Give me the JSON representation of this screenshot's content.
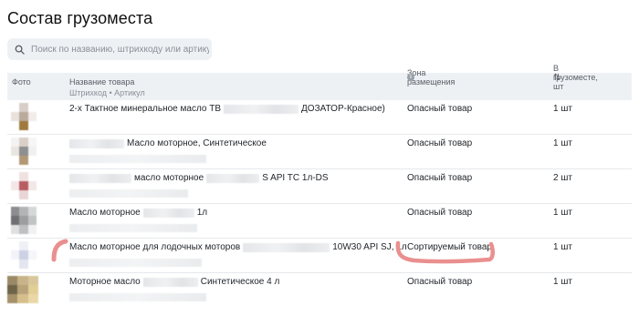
{
  "page": {
    "title": "Состав грузоместа"
  },
  "search": {
    "placeholder": "Поиск по названию, штрихкоду или артикулу",
    "value": ""
  },
  "table": {
    "columns": {
      "photo": "Фото",
      "name": "Название товара",
      "name_sub": "Штрихкод • Артикул",
      "zone": "Зона размещения",
      "count": "В грузоместе, шт"
    },
    "rows": [
      {
        "name_parts": [
          "2-х Тактное минеральное масло ТВ",
          "ДОЗАТОР-Красное)"
        ],
        "zone": "Опасный товар",
        "count": "1 шт",
        "thumb_colors": [
          "#ffffff",
          "#d7cfc8",
          "#ffffff",
          "#e8e2dd",
          "#b9aa9c",
          "#f1ece7",
          "#ffffff",
          "#a07a3c",
          "#ffffff"
        ]
      },
      {
        "name_parts": [
          "",
          "Масло моторное, Синтетическое"
        ],
        "zone": "Опасный товар",
        "count": "1 шт",
        "thumb_colors": [
          "#f3f3f3",
          "#d9d0c8",
          "#f6f6f6",
          "#e9e6e2",
          "#8e8f90",
          "#f0f0f0",
          "#ffffff",
          "#b39876",
          "#ffffff"
        ]
      },
      {
        "name_parts": [
          "",
          "масло моторное",
          "S API TC 1л-DS"
        ],
        "zone": "Опасный товар",
        "count": "2 шт",
        "thumb_colors": [
          "#ffffff",
          "#f0e1e1",
          "#ffffff",
          "#f3e6e6",
          "#b95c62",
          "#f2e7e7",
          "#ffffff",
          "#e9d5d7",
          "#ffffff"
        ]
      },
      {
        "name_parts": [
          "Масло моторное",
          "1л"
        ],
        "zone": "Опасный товар",
        "count": "1 шт",
        "thumb_colors": [
          "#8c8d8f",
          "#b3b4b6",
          "#d6d7d8",
          "#6f7072",
          "#9d9ea0",
          "#c2c3c5",
          "#dfe0e1",
          "#bfc0c2",
          "#f1f1f2"
        ]
      },
      {
        "name_parts": [
          "Масло моторное для лодочных моторов",
          "10W30 API SJ, 1л"
        ],
        "zone": "Сортируемый товар",
        "count": "1 шт",
        "thumb_colors": [
          "#ffffff",
          "#eef0f6",
          "#ffffff",
          "#f2f3f8",
          "#cdd1e3",
          "#f5f6fa",
          "#ffffff",
          "#e3e6ef",
          "#ffffff"
        ]
      },
      {
        "name_parts": [
          "Моторное масло",
          "Синтетическое 4 л"
        ],
        "zone": "Опасный товар",
        "count": "1 шт",
        "thumb_colors": [
          "#9b8a67",
          "#c7b48a",
          "#d8c79a",
          "#6e6549",
          "#b8a27a",
          "#e2cf96",
          "#a5926a",
          "#d7bf8d",
          "#e9d8a6"
        ]
      }
    ]
  },
  "colors": {
    "header_bg": "#eef1f4",
    "annotation": "#ea8f8f"
  },
  "icons": {
    "search": "search-icon",
    "info": "info-icon",
    "sort": "sort-icon"
  }
}
